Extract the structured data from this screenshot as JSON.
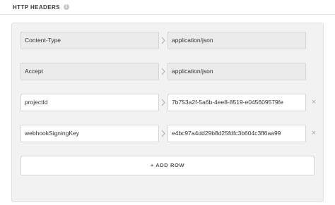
{
  "section": {
    "title": "HTTP HEADERS",
    "info_icon": "info-icon",
    "info_glyph": "i"
  },
  "headers": [
    {
      "key": "Content-Type",
      "value": "application/json",
      "editable": false
    },
    {
      "key": "Accept",
      "value": "application/json",
      "editable": false
    },
    {
      "key": "projectId",
      "value": "7b753a2f-5a6b-4ee8-8519-e045609579fe",
      "editable": true
    },
    {
      "key": "webhookSigningKey",
      "value": "e4bc97a4dd29b8d25fdfc3b604c3ff6aa99",
      "editable": true
    }
  ],
  "remove_glyph": "×",
  "add_row_label": "+ ADD ROW",
  "colors": {
    "panel_bg": "#f2f2f2",
    "readonly_field_bg": "#ebebeb",
    "border": "#d6d6d6",
    "remove_icon": "#a8a8a8"
  }
}
